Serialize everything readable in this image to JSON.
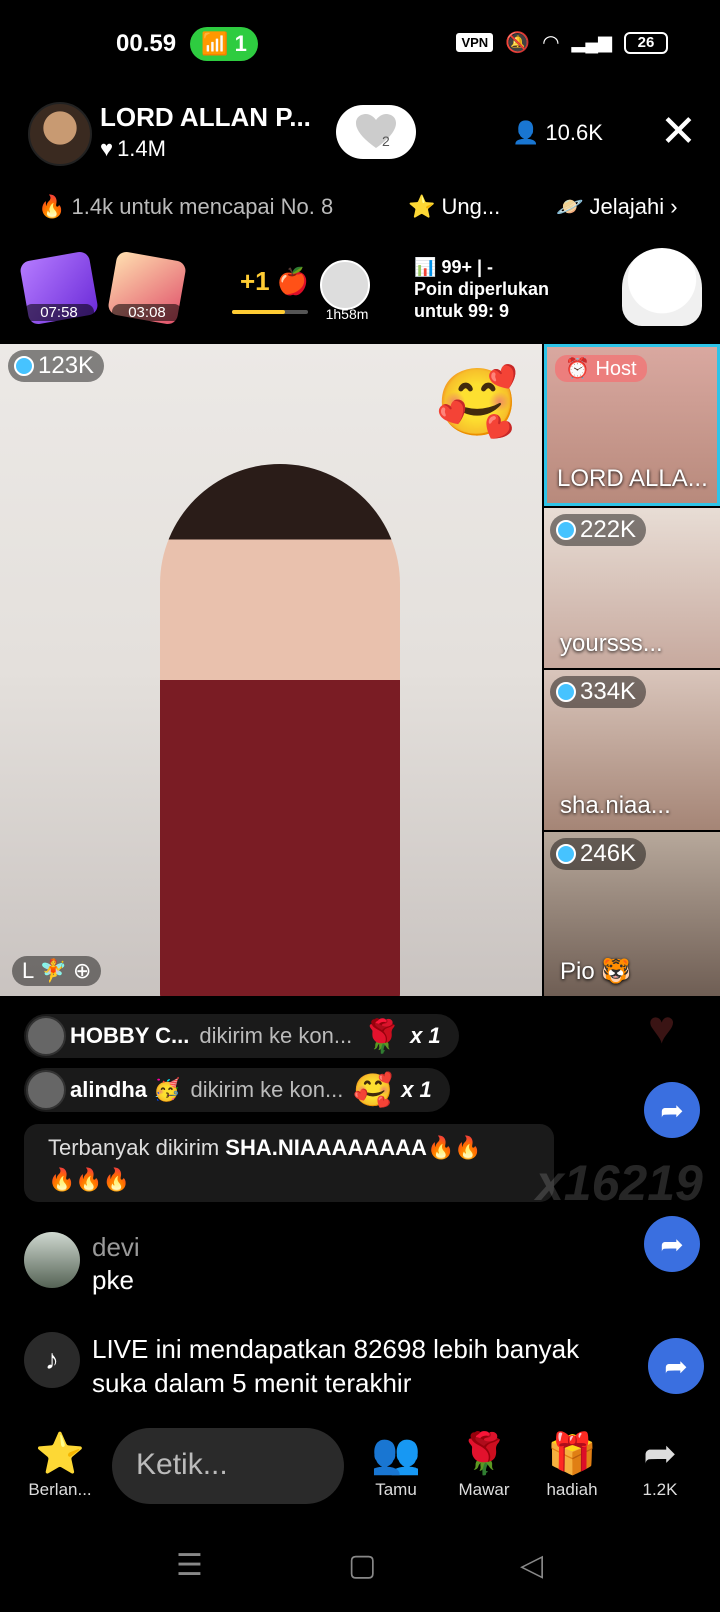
{
  "status_bar": {
    "time": "00.59",
    "hotspot_count": "1",
    "vpn": "VPN",
    "battery": "26"
  },
  "header": {
    "host_name": "LORD ALLAN P...",
    "host_likes": "1.4M",
    "follow_badge_count": "2",
    "viewers": "10.6K",
    "close_icon": "close-icon"
  },
  "info_row": {
    "rank_text": "1.4k untuk mencapai No. 8",
    "ung_label": "Ung...",
    "explore_label": "Jelajahi"
  },
  "icons_row": {
    "chest1_time": "07:58",
    "chest2_time": "03:08",
    "plus_one": "+1",
    "progress_fraction": 0.7,
    "mini_time": "1h58m",
    "points_top": "99+ | -",
    "points_line1": "Poin diperlukan",
    "points_line2": "untuk 99: 9"
  },
  "grid": {
    "main_count": "123K",
    "main_badge": "L 🧚 ⊕",
    "host_tag": "Host",
    "tiles": [
      {
        "count": "",
        "label": "LORD ALLA..."
      },
      {
        "count": "222K",
        "label": "yoursss..."
      },
      {
        "count": "334K",
        "label": "sha.niaa..."
      },
      {
        "count": "246K",
        "label": "Pio 🐯"
      }
    ]
  },
  "gifts": [
    {
      "user": "HOBBY C...",
      "action": "dikirim ke kon...",
      "gift": "🌹",
      "count": "x 1"
    },
    {
      "user": "alindha 🥳",
      "action": "dikirim ke kon...",
      "gift": "🥰",
      "count": "x 1"
    }
  ],
  "top_sent": {
    "prefix": "Terbanyak dikirim ",
    "name": "SHA.NIAAAAAAAA🔥🔥",
    "line2": "🔥🔥🔥"
  },
  "watermark": "x16219",
  "comments": [
    {
      "name": "devi",
      "text": "pke"
    },
    {
      "name": "",
      "text": "LIVE ini mendapatkan 82698 lebih banyak suka dalam 5 menit terakhir"
    }
  ],
  "bottom_bar": {
    "berlan": "Berlan...",
    "input_placeholder": "Ketik...",
    "tamu": "Tamu",
    "mawar": "Mawar",
    "hadiah": "hadiah",
    "share_count": "1.2K"
  },
  "colors": {
    "accent_blue": "#3a6fe0",
    "hotspot_green": "#2ecc40",
    "host_border": "#2ec4e8"
  }
}
